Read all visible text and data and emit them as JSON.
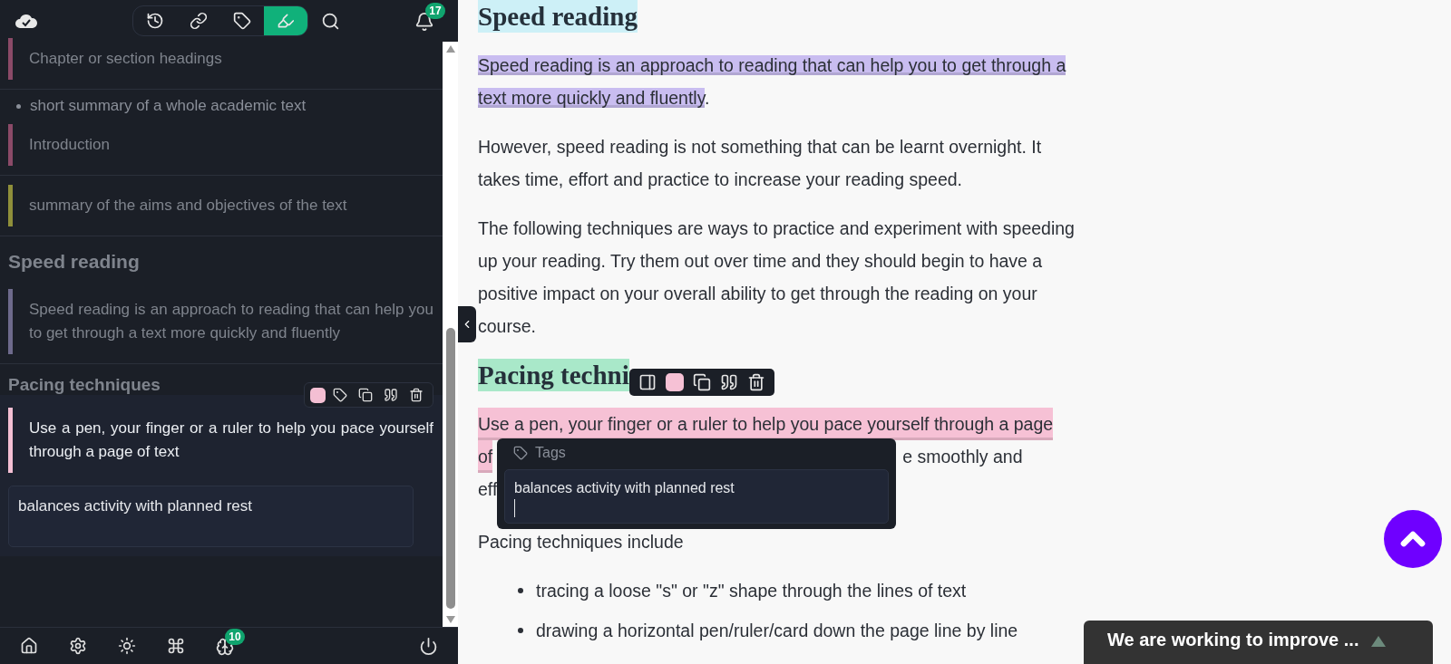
{
  "top_bar": {
    "tabs": [
      {
        "kind": "history",
        "selected": false
      },
      {
        "kind": "link",
        "selected": false
      },
      {
        "kind": "tag",
        "selected": false
      },
      {
        "kind": "highlighter",
        "selected": true
      }
    ],
    "notification_count": "17"
  },
  "sidebar": {
    "entries": [
      {
        "kind": "highlight",
        "text": "Chapter or section headings",
        "color": "#8b4a68",
        "selected": false
      },
      {
        "kind": "bullet",
        "text": "short summary of a whole academic text"
      },
      {
        "kind": "highlight",
        "text": "Introduction",
        "color": "#8b4a68",
        "selected": false
      },
      {
        "kind": "highlight",
        "text": "summary of the aims and objectives of the text",
        "color": "#8f8f3a",
        "selected": false
      },
      {
        "kind": "heading",
        "text": "Speed reading"
      },
      {
        "kind": "highlight",
        "text": "Speed reading is an approach to reading that can help you to get through a text more quickly and fluently",
        "color": "#6e6a8c",
        "selected": false
      },
      {
        "kind": "heading",
        "text": "Pacing techniques"
      },
      {
        "kind": "highlight",
        "text": "Use a pen, your finger or a ruler to help you pace yourself through a page of text",
        "color": "#f4bfd3",
        "selected": true,
        "note": "balances activity with planned rest"
      }
    ]
  },
  "bottom_bar": {
    "badge": "10"
  },
  "article": {
    "blocks": [
      {
        "kind": "heading",
        "text": "Speed reading",
        "color": "#cdf0f7"
      },
      {
        "kind": "paragraph",
        "segments": [
          {
            "text": "Speed reading is an approach to reading that can help you to get through a text more quickly and fluently",
            "color": "#c9bdf0"
          },
          {
            "text": "."
          }
        ]
      },
      {
        "kind": "paragraph",
        "segments": [
          {
            "text": "However, speed reading is not something that can be learnt overnight. It takes time, effort and practice to increase your reading speed."
          }
        ]
      },
      {
        "kind": "paragraph",
        "segments": [
          {
            "text": "The following techniques are ways to practice and experiment with speeding up your reading. Try them out over time and they should begin to have a positive impact on your overall ability to get through the reading on your course."
          }
        ]
      },
      {
        "kind": "heading",
        "text": "Pacing techni",
        "color": "#a9e8c9"
      },
      {
        "kind": "covered",
        "lines": [
          [
            {
              "text": "Use a pen, your finger or a ruler to help you pace yourself through a page",
              "color": "#f6c1d5"
            }
          ],
          [
            {
              "text": "of",
              "color": "#f6c1d5"
            },
            {
              "text": "e smoothly and"
            }
          ],
          [
            {
              "text": "eff"
            }
          ]
        ]
      },
      {
        "kind": "paragraph",
        "segments": [
          {
            "text": "Pacing techniques include"
          }
        ]
      },
      {
        "kind": "list",
        "items": [
          "tracing a loose \"s\" or \"z\" shape through the lines of text",
          "drawing a horizontal pen/ruler/card down the page line by line"
        ]
      }
    ]
  },
  "selection_toolbar": {
    "color": "#f6c1d5"
  },
  "tags_popup": {
    "label": "Tags",
    "value": "balances activity with planned rest"
  },
  "feedback_toast": {
    "text": "We are working to improve ..."
  }
}
